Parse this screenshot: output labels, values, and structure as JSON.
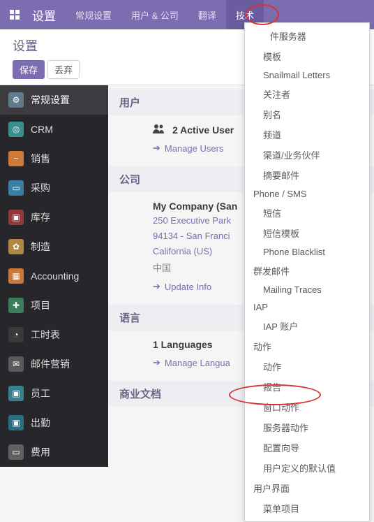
{
  "top": {
    "title": "设置",
    "tabs": [
      "常规设置",
      "用户 & 公司",
      "翻译",
      "技术"
    ]
  },
  "sub": {
    "title": "设置",
    "save": "保存",
    "discard": "丢弃"
  },
  "sidebar": [
    {
      "label": "常规设置",
      "bg": "#5f7b8c"
    },
    {
      "label": "CRM",
      "bg": "#3a8e8e"
    },
    {
      "label": "销售",
      "bg": "#d07a3a"
    },
    {
      "label": "采购",
      "bg": "#3a7fa3"
    },
    {
      "label": "库存",
      "bg": "#8e3a3a"
    },
    {
      "label": "制造",
      "bg": "#b08844"
    },
    {
      "label": "Accounting",
      "bg": "#c97a3a"
    },
    {
      "label": "项目",
      "bg": "#3a7f5a"
    },
    {
      "label": "工时表",
      "bg": "#3a3a3a"
    },
    {
      "label": "邮件营销",
      "bg": "#5a5a5a"
    },
    {
      "label": "员工",
      "bg": "#3a7f8e"
    },
    {
      "label": "出勤",
      "bg": "#2a6f7f"
    },
    {
      "label": "费用",
      "bg": "#606060"
    }
  ],
  "sections": {
    "users": {
      "head": "用户",
      "summary": "2 Active User",
      "link": "Manage Users"
    },
    "company": {
      "head": "公司",
      "name": "My Company (San",
      "addr1": "250 Executive Park",
      "addr2": "94134 - San Franci",
      "addr3": "California (US)",
      "country": "中国",
      "link": "Update Info"
    },
    "lang": {
      "head": "语言",
      "summary": "1 Languages",
      "link": "Manage Langua"
    },
    "doc": {
      "head": "商业文档"
    }
  },
  "dropdown": {
    "g0": "ㅤㅤ件服务器",
    "i0": [
      "模板",
      "Snailmail Letters",
      "关注者",
      "别名",
      "频道",
      "渠道/业务伙伴",
      "摘要邮件"
    ],
    "g1": "Phone / SMS",
    "i1": [
      "短信",
      "短信模板",
      "Phone Blacklist"
    ],
    "g2": "群发邮件",
    "i2": [
      "Mailing Traces"
    ],
    "g3": "IAP",
    "i3": [
      "IAP 账户"
    ],
    "g4": "动作",
    "i4": [
      "动作",
      "报告",
      "窗口动作",
      "服务器动作",
      "配置向导",
      "用户定义的默认值"
    ],
    "g5": "用户界面",
    "i5": [
      "菜单项目"
    ]
  }
}
